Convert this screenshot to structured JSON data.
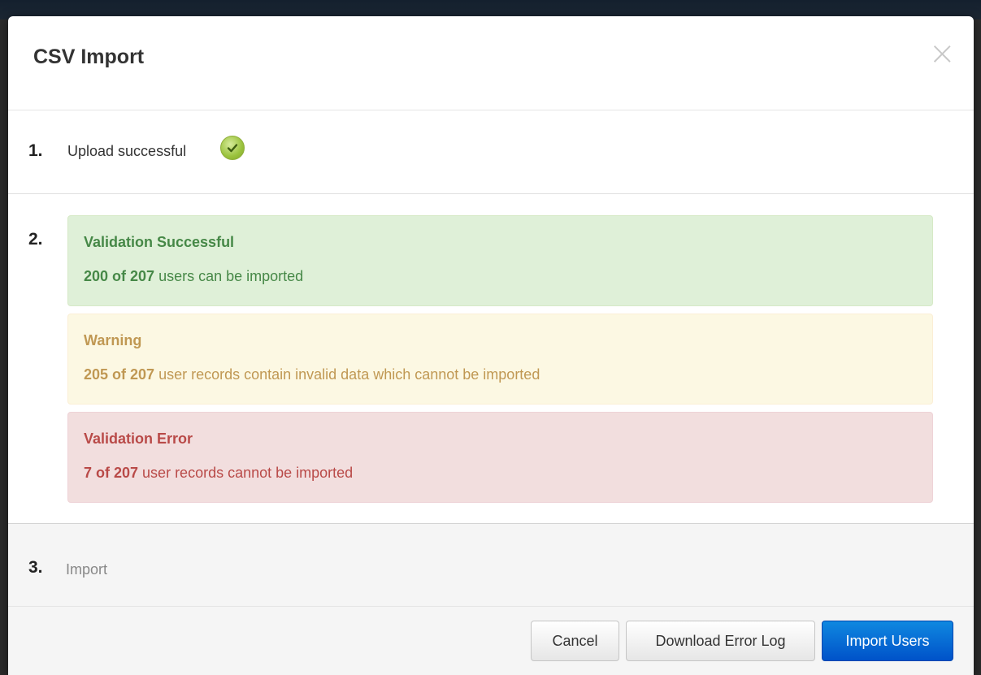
{
  "modal": {
    "title": "CSV Import",
    "close_symbol": "×"
  },
  "steps": {
    "step1": {
      "number": "1.",
      "label": "Upload successful",
      "icon": "check-icon"
    },
    "step2": {
      "number": "2.",
      "alerts": {
        "success": {
          "title": "Validation Successful",
          "count": "200 of 207",
          "text": " users can be imported"
        },
        "warning": {
          "title": "Warning",
          "count": "205 of 207",
          "text": " user records contain invalid data which cannot be imported"
        },
        "error": {
          "title": "Validation Error",
          "count": "7 of 207",
          "text": " user records cannot be imported"
        }
      }
    },
    "step3": {
      "number": "3.",
      "label": "Import"
    }
  },
  "footer": {
    "cancel_label": "Cancel",
    "download_label": "Download Error Log",
    "import_label": "Import Users"
  },
  "colors": {
    "success": "#468847",
    "warning": "#c09853",
    "error": "#b94a48",
    "primary": "#0a6fd8"
  }
}
